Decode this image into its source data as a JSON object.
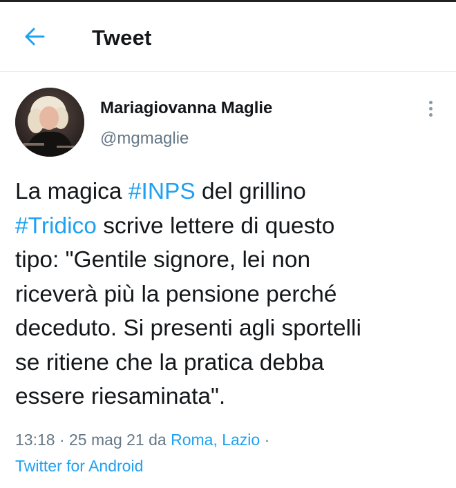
{
  "header": {
    "title": "Tweet",
    "back_icon": "arrow-left-icon",
    "accent": "#1da1f2"
  },
  "author": {
    "display_name": "Mariagiovanna Maglie",
    "handle": "@mgmaglie",
    "avatar_icon": "profile-photo"
  },
  "tweet": {
    "lines": [
      [
        {
          "text": "La magica "
        },
        {
          "text": "#INPS",
          "hashtag": true
        },
        {
          "text": " del grillino"
        }
      ],
      [
        {
          "text": "#Tridico",
          "hashtag": true
        },
        {
          "text": " scrive lettere di questo"
        }
      ],
      [
        {
          "text": "tipo: \"Gentile signore, lei non"
        }
      ],
      [
        {
          "text": "riceverà più la pensione perché"
        }
      ],
      [
        {
          "text": "deceduto. Si presenti agli sportelli"
        }
      ],
      [
        {
          "text": "se ritiene che la pratica debba"
        }
      ],
      [
        {
          "text": "essere riesaminata\"."
        }
      ]
    ]
  },
  "meta": {
    "time": "13:18",
    "separator": " · ",
    "date": "25 mag 21",
    "from_word": " da ",
    "location": "Roma, Lazio",
    "trailing_separator": " ·",
    "source": "Twitter for Android"
  },
  "colors": {
    "text": "#14171a",
    "secondary": "#657786",
    "link": "#1da1f2",
    "divider": "#e6ecf0"
  }
}
